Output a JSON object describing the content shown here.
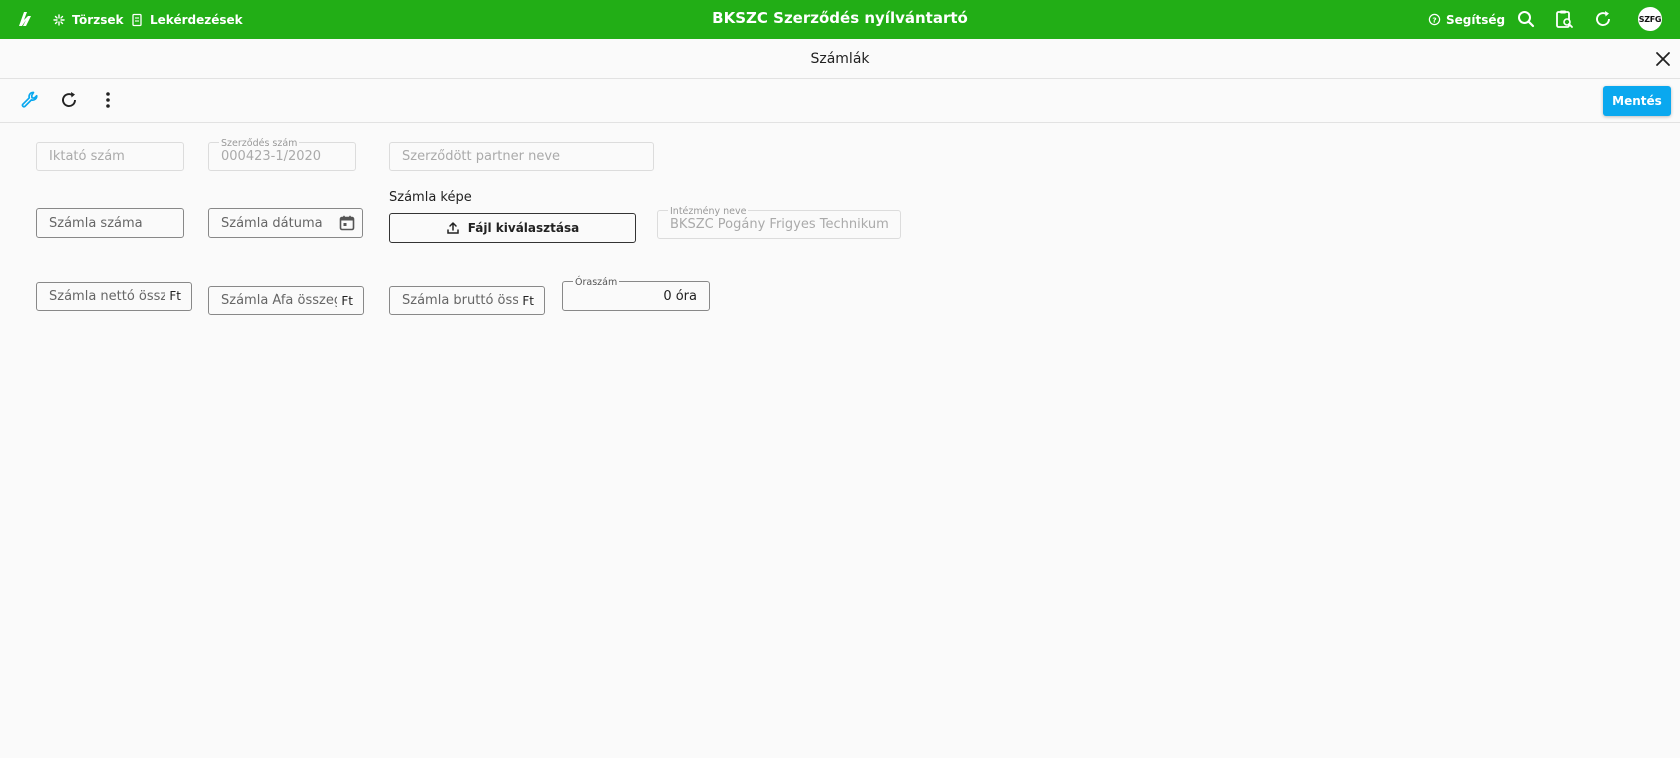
{
  "app": {
    "title": "BKSZC Szerződés nyílvántartó",
    "nav": [
      {
        "label": "Törzsek",
        "icon": "sparkle-icon"
      },
      {
        "label": "Lekérdezések",
        "icon": "document-icon"
      }
    ],
    "help_label": "Segítség",
    "user_initials": "SZFG",
    "colors": {
      "topbar": "#22ae16",
      "save_button": "#0aa8ef"
    }
  },
  "page": {
    "title": "Számlák",
    "save_label": "Mentés"
  },
  "form": {
    "iktato_szam": {
      "placeholder": "Iktató szám",
      "value": ""
    },
    "szerzodes_szam": {
      "label": "Szerződés szám",
      "value": "000423-1/2020"
    },
    "partner_neve": {
      "placeholder": "Szerződött partner neve",
      "value": ""
    },
    "szamla_szama": {
      "placeholder": "Számla száma",
      "value": ""
    },
    "szamla_datuma": {
      "placeholder": "Számla dátuma",
      "value": ""
    },
    "szamla_kepe": {
      "label": "Számla képe",
      "button_label": "Fájl kiválasztása"
    },
    "intezmeny_neve": {
      "label": "Intézmény neve",
      "value": "BKSZC Pogány Frigyes Technikum"
    },
    "netto": {
      "placeholder": "Számla nettó összeg",
      "suffix": "Ft",
      "value": ""
    },
    "afa": {
      "placeholder": "Számla Áfa összeg",
      "suffix": "Ft",
      "value": ""
    },
    "brutto": {
      "placeholder": "Számla bruttó összeg",
      "suffix": "Ft",
      "value": ""
    },
    "oraszam": {
      "label": "Óraszám",
      "value": "0 óra"
    }
  }
}
